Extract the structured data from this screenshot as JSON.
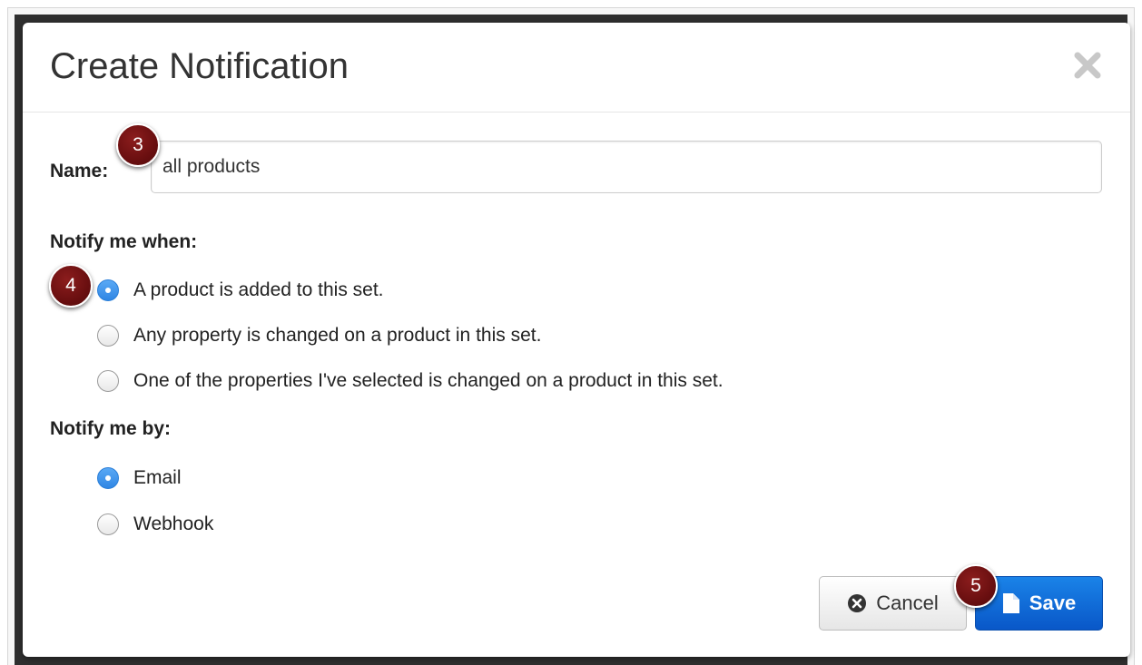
{
  "modal": {
    "title": "Create Notification",
    "close_icon": "close-x-icon"
  },
  "form": {
    "name_label": "Name:",
    "name_value": "all products",
    "notify_when_label": "Notify me when:",
    "notify_when_options": [
      {
        "label": "A product is added to this set.",
        "checked": true
      },
      {
        "label": "Any property is changed on a product in this set.",
        "checked": false
      },
      {
        "label": "One of the properties I've selected is changed on a product in this set.",
        "checked": false
      }
    ],
    "notify_by_label": "Notify me by:",
    "notify_by_options": [
      {
        "label": "Email",
        "checked": true
      },
      {
        "label": "Webhook",
        "checked": false
      }
    ]
  },
  "buttons": {
    "cancel_label": "Cancel",
    "cancel_icon": "times-circle-icon",
    "save_label": "Save",
    "save_icon": "file-icon"
  },
  "callouts": [
    "3",
    "4",
    "5"
  ],
  "colors": {
    "primary": "#0f6ad8",
    "radio_checked": "#3a8ee8",
    "badge": "#6a0f10"
  }
}
